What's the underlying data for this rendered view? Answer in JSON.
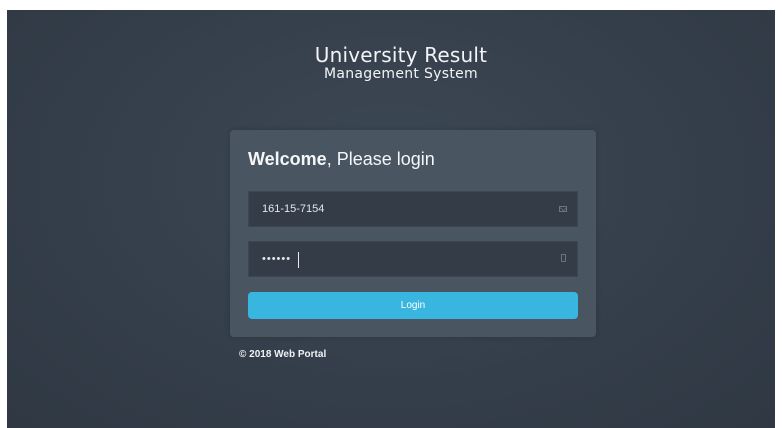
{
  "header": {
    "title_line1": "University Result",
    "title_line2": "Management System"
  },
  "login_form": {
    "welcome_bold": "Welcome",
    "welcome_rest": ", Please login",
    "username_value": "161-15-7154",
    "password_value": "••••••",
    "login_label": "Login"
  },
  "icons": {
    "username_field": "envelope-icon",
    "password_field": "lock-icon"
  },
  "colors": {
    "background": "#343e4a",
    "card": "#4a5562",
    "input": "#343c47",
    "button": "#39b6e0"
  },
  "footer": {
    "copyright": "© 2018 Web Portal"
  }
}
